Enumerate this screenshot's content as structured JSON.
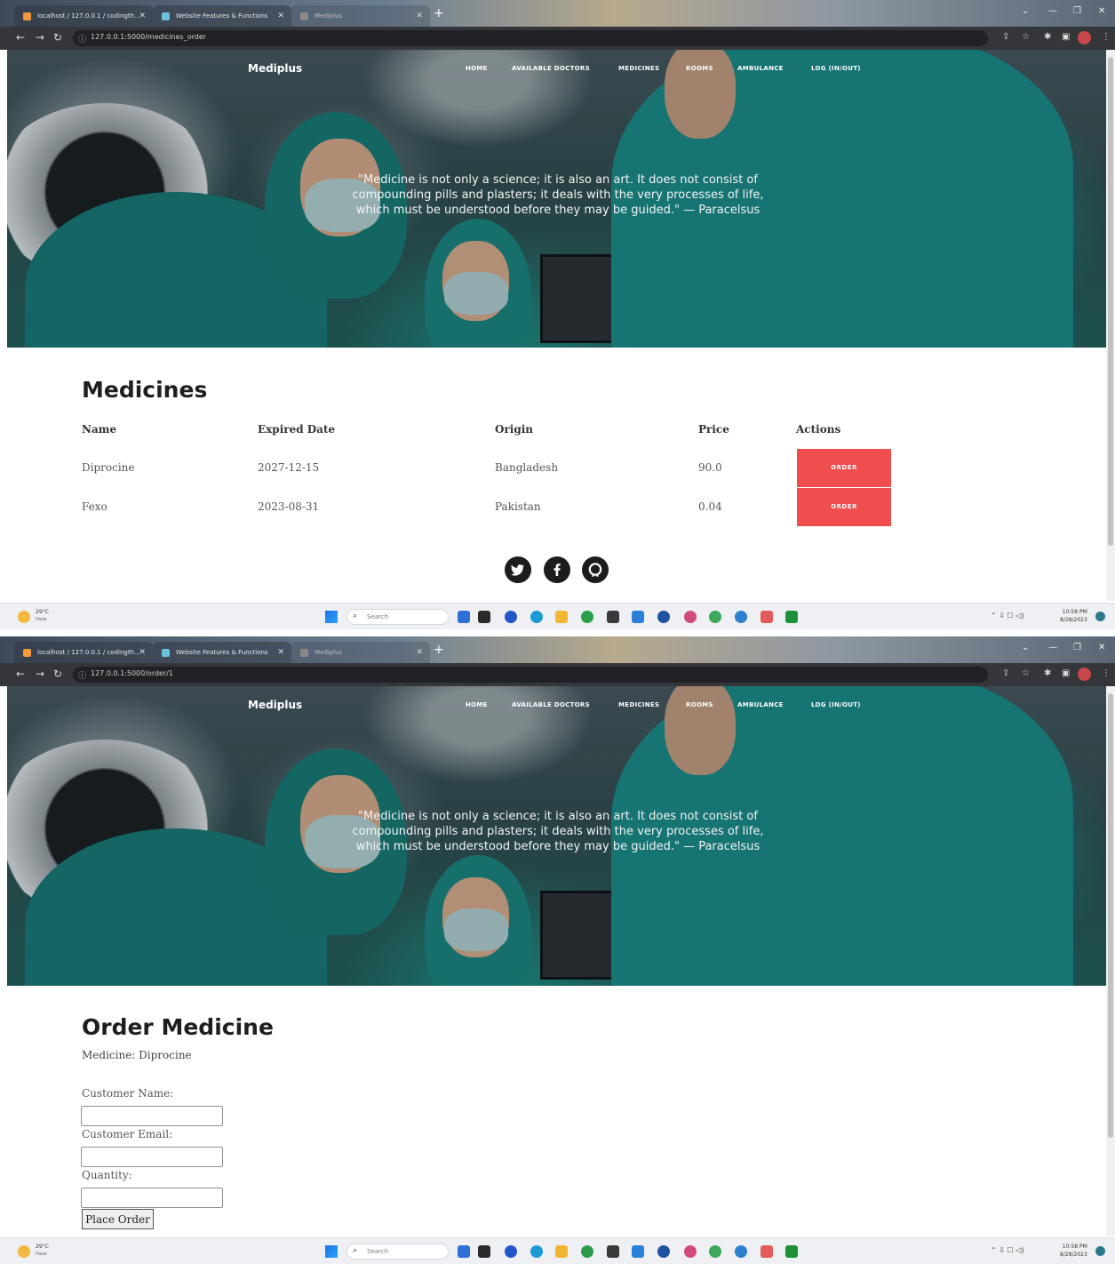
{
  "browser": {
    "tabs": [
      {
        "label": "localhost / 127.0.0.1 / codingth..."
      },
      {
        "label": "Website Features & Functions"
      },
      {
        "label": "Mediplus"
      }
    ],
    "new_tab": "+",
    "url_list": "127.0.0.1:5000/medicines_order",
    "url_order": "127.0.0.1:5000/order/1"
  },
  "site": {
    "brand": "Mediplus",
    "nav": [
      "HOME",
      "AVAILABLE DOCTORS",
      "MEDICINES",
      "ROOMS",
      "AMBULANCE",
      "LOG (IN/OUT)"
    ],
    "quote": "\"Medicine is not only a science; it is also an art. It does not consist of compounding pills and plasters; it deals with the very processes of life, which must be understood before they may be guided.\" — Paracelsus"
  },
  "medicines_page": {
    "title": "Medicines",
    "columns": [
      "Name",
      "Expired Date",
      "Origin",
      "Price",
      "Actions"
    ],
    "rows": [
      {
        "name": "Diprocine",
        "expired": "2027-12-15",
        "origin": "Bangladesh",
        "price": "90.0",
        "action": "ORDER"
      },
      {
        "name": "Fexo",
        "expired": "2023-08-31",
        "origin": "Pakistan",
        "price": "0.04",
        "action": "ORDER"
      }
    ],
    "social_icons": [
      "twitter-icon",
      "facebook-icon",
      "github-icon"
    ]
  },
  "order_page": {
    "title": "Order Medicine",
    "medicine_line": "Medicine: Diprocine",
    "customer_name_label": "Customer Name:",
    "customer_email_label": "Customer Email:",
    "quantity_label": "Quantity:",
    "customer_name_value": "",
    "customer_email_value": "",
    "quantity_value": "",
    "submit_label": "Place Order"
  },
  "taskbar": {
    "temperature": "29°C",
    "condition": "Haze",
    "search_placeholder": "Search",
    "time": "10:58 PM",
    "date": "8/28/2023"
  },
  "colors": {
    "order_button": "#ef4d4e",
    "hero_teal": "#1a8583",
    "chrome_dark": "#35363a"
  }
}
